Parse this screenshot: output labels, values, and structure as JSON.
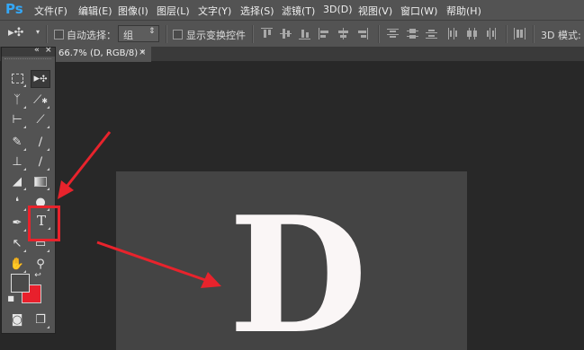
{
  "app": {
    "logo": "Ps"
  },
  "menu": [
    "文件(F)",
    "编辑(E)",
    "图像(I)",
    "图层(L)",
    "文字(Y)",
    "选择(S)",
    "滤镜(T)",
    "3D(D)",
    "视图(V)",
    "窗口(W)",
    "帮助(H)"
  ],
  "options": {
    "auto_select_label": "自动选择：",
    "auto_select_value": "组",
    "show_transform_label": "显示变换控件",
    "mode_3d_label": "3D 模式:"
  },
  "document": {
    "tab_title": "66.7% (D, RGB/8) *",
    "tab_close": "×",
    "canvas_text": "D"
  },
  "toolbox": {
    "collapse": "«",
    "close": "×"
  },
  "colors": {
    "accent_ps": "#34a8f8",
    "highlight": "#e8232c",
    "background_swatch": "#e8202c",
    "foreground_swatch": "#4a4a4a",
    "letter": "#faf6f6"
  }
}
